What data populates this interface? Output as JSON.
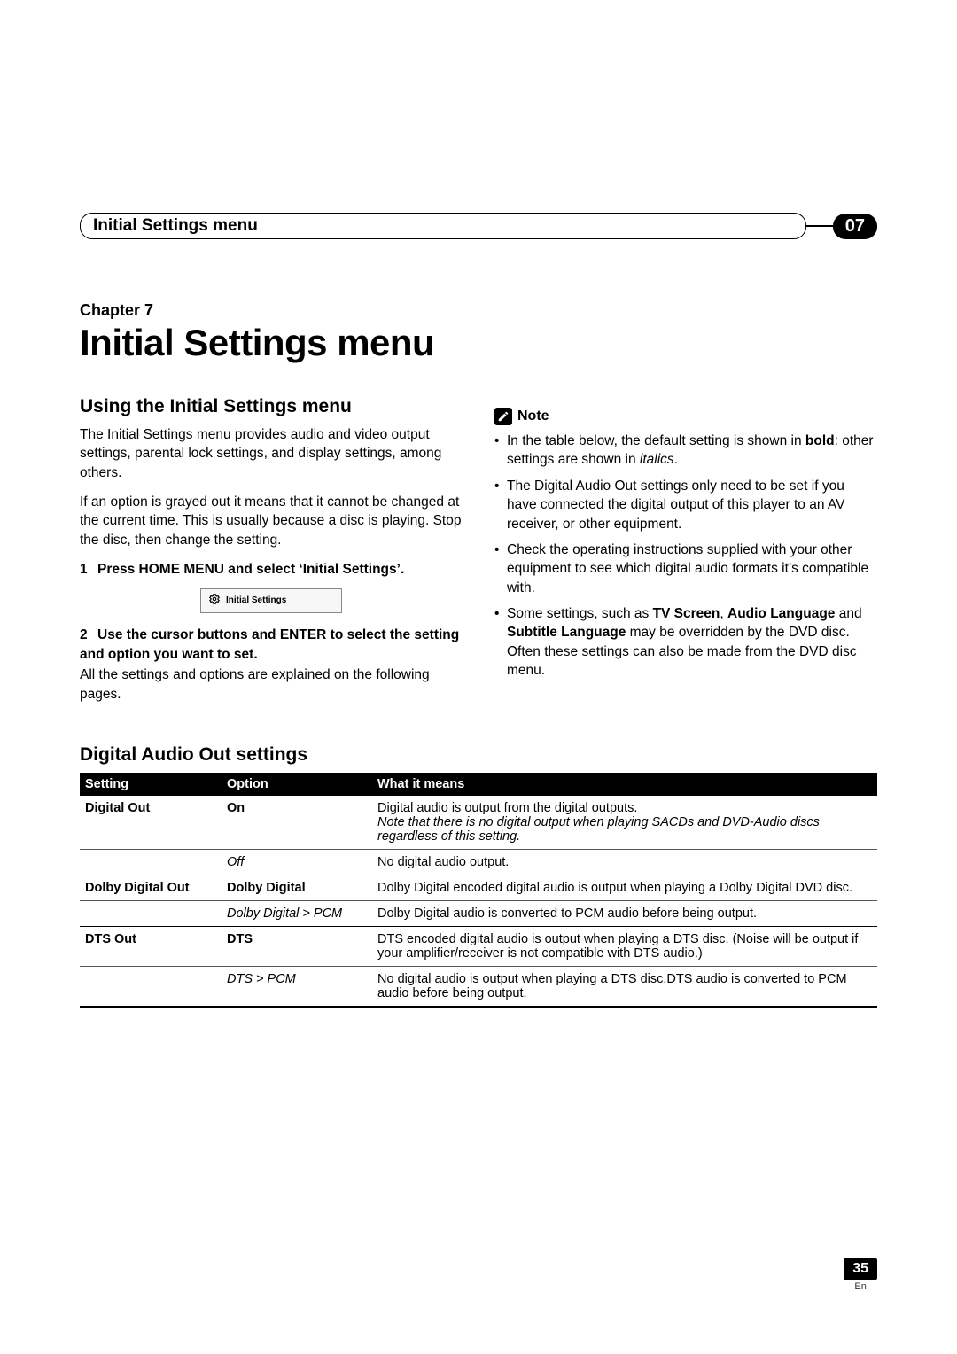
{
  "header": {
    "title": "Initial Settings menu",
    "chapter_number": "07"
  },
  "chapter": {
    "label": "Chapter 7",
    "title": "Initial Settings menu"
  },
  "left": {
    "heading": "Using the Initial Settings menu",
    "p1": "The Initial Settings menu provides audio and video output settings, parental lock settings, and display settings, among others.",
    "p2": "If an option is grayed out it means that it cannot be changed at the current time. This is usually because a disc is playing. Stop the disc, then change the setting.",
    "step1_num": "1",
    "step1": "Press HOME MENU and select ‘Initial Settings’.",
    "menu_item": "Initial Settings",
    "step2_num": "2",
    "step2": "Use the cursor buttons and ENTER to select the setting and option you want to set.",
    "p3": "All the settings and options are explained on the following pages."
  },
  "right": {
    "note_label": "Note",
    "bullets": {
      "b1_pre": "In the table below, the default setting is shown in ",
      "b1_bold": "bold",
      "b1_mid": ": other settings are shown in ",
      "b1_ital": "italics",
      "b1_post": ".",
      "b2": "The Digital Audio Out settings only need to be set if you have connected the digital output of this player to an AV receiver, or other equipment.",
      "b3": "Check the operating instructions supplied with your other equipment to see which digital audio formats it’s compatible with.",
      "b4_pre": "Some settings, such as ",
      "b4_b1": "TV Screen",
      "b4_m1": ", ",
      "b4_b2": "Audio Language",
      "b4_m2": " and ",
      "b4_b3": "Subtitle Language",
      "b4_post": " may be overridden by the DVD disc. Often these settings can also be made from the DVD disc menu."
    }
  },
  "table": {
    "heading": "Digital Audio Out settings",
    "cols": {
      "c1": "Setting",
      "c2": "Option",
      "c3": "What it means"
    },
    "rows": [
      {
        "setting": "Digital Out",
        "option": "On",
        "opt_class": "default",
        "meaning": "Digital audio is output from the digital outputs.",
        "meaning_note": "Note that there is no digital output when playing SACDs and DVD-Audio discs regardless of this setting.",
        "row_class": "inner"
      },
      {
        "setting": "",
        "option": "Off",
        "opt_class": "alt",
        "meaning": "No digital audio output.",
        "row_class": ""
      },
      {
        "setting": "Dolby Digital Out",
        "option": "Dolby Digital",
        "opt_class": "default",
        "meaning": "Dolby Digital encoded digital audio is output when playing a Dolby Digital DVD disc.",
        "row_class": "inner"
      },
      {
        "setting": "",
        "option": "Dolby Digital > PCM",
        "opt_class": "alt",
        "meaning": "Dolby Digital audio is converted to PCM audio before being output.",
        "row_class": ""
      },
      {
        "setting": "DTS Out",
        "option": "DTS",
        "opt_class": "default",
        "meaning": "DTS encoded digital audio is output when playing a DTS disc. (Noise will be output if your amplifier/receiver is not compatible with DTS audio.)",
        "row_class": "inner"
      },
      {
        "setting": "",
        "option": "DTS > PCM",
        "opt_class": "alt",
        "meaning": "No digital audio is output when playing a DTS disc.DTS audio is converted to PCM audio before being output.",
        "row_class": "last"
      }
    ]
  },
  "footer": {
    "page": "35",
    "lang": "En"
  }
}
